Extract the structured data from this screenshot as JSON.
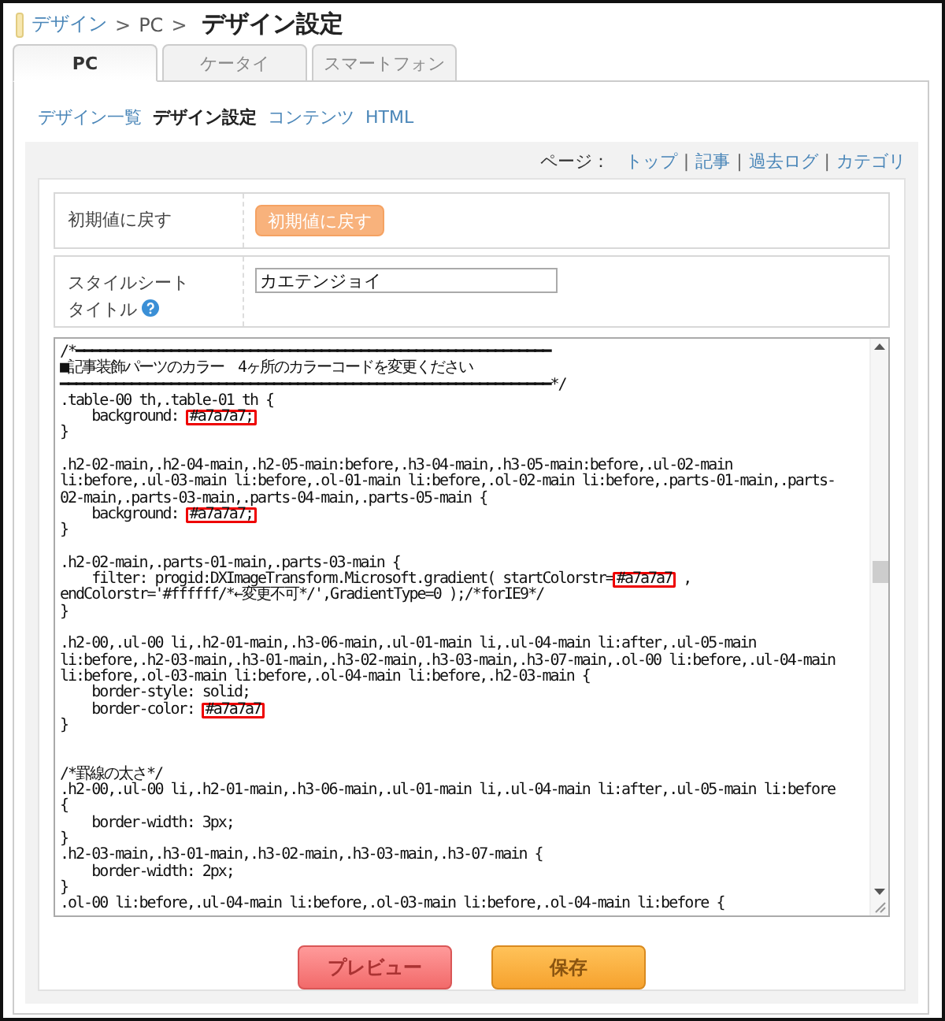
{
  "breadcrumb": {
    "items": [
      {
        "label": "デザイン",
        "kind": "link"
      },
      {
        "label": "PC",
        "kind": "plain"
      }
    ],
    "separator": ">",
    "current": "デザイン設定"
  },
  "tabs": [
    {
      "label": "PC",
      "selected": true
    },
    {
      "label": "ケータイ",
      "selected": false
    },
    {
      "label": "スマートフォン",
      "selected": false
    }
  ],
  "subnav": [
    {
      "label": "デザイン一覧",
      "selected": false
    },
    {
      "label": "デザイン設定",
      "selected": true
    },
    {
      "label": "コンテンツ",
      "selected": false
    },
    {
      "label": "HTML",
      "selected": false
    }
  ],
  "page_links": {
    "label": "ページ：",
    "separator": "|",
    "links": [
      "トップ",
      "記事",
      "過去ログ",
      "カテゴリ"
    ]
  },
  "reset_row": {
    "label": "初期値に戻す",
    "button": "初期値に戻す"
  },
  "title_row": {
    "label_lines": [
      "スタイルシート",
      "タイトル"
    ],
    "value": "カエテンジョイ"
  },
  "code_lines": [
    {
      "kind": "code",
      "text": "/*━━━━━━━━━━━━━━━━━━━━━━━━━━━━━━━━━━━━━━━━━━━━━━━━━━━━━━━━━━━━"
    },
    {
      "kind": "code",
      "text": "■記事装飾パーツのカラー　4ヶ所のカラーコードを変更ください"
    },
    {
      "kind": "code",
      "text": "━━━━━━━━━━━━━━━━━━━━━━━━━━━━━━━━━━━━━━━━━━━━━━━━━━━━━━━━━━━━━━*/"
    },
    {
      "kind": "code",
      "text": ".table-00 th,.table-01 th {"
    },
    {
      "kind": "marked",
      "text": "    background: ",
      "mark": "#a7a7a7;"
    },
    {
      "kind": "code",
      "text": "}"
    },
    {
      "kind": "blank"
    },
    {
      "kind": "code",
      "text": ".h2-02-main,.h2-04-main,.h2-05-main:before,.h3-04-main,.h3-05-main:before,.ul-02-main"
    },
    {
      "kind": "code",
      "text": "li:before,.ul-03-main li:before,.ol-01-main li:before,.ol-02-main li:before,.parts-01-main,.parts-"
    },
    {
      "kind": "code",
      "text": "02-main,.parts-03-main,.parts-04-main,.parts-05-main {"
    },
    {
      "kind": "marked",
      "text": "    background: ",
      "mark": "#a7a7a7;"
    },
    {
      "kind": "code",
      "text": "}"
    },
    {
      "kind": "blank"
    },
    {
      "kind": "code",
      "text": ".h2-02-main,.parts-01-main,.parts-03-main {"
    },
    {
      "kind": "marked",
      "text": "    filter: progid:DXImageTransform.Microsoft.gradient( startColorstr=",
      "mark": "#a7a7a7",
      "rest": " ,"
    },
    {
      "kind": "code",
      "text": "endColorstr='#ffffff/*←変更不可*/',GradientType=0 );/*forIE9*/"
    },
    {
      "kind": "code",
      "text": "}"
    },
    {
      "kind": "blank"
    },
    {
      "kind": "code",
      "text": ".h2-00,.ul-00 li,.h2-01-main,.h3-06-main,.ul-01-main li,.ul-04-main li:after,.ul-05-main"
    },
    {
      "kind": "code",
      "text": "li:before,.h2-03-main,.h3-01-main,.h3-02-main,.h3-03-main,.h3-07-main,.ol-00 li:before,.ul-04-main"
    },
    {
      "kind": "code",
      "text": "li:before,.ol-03-main li:before,.ol-04-main li:before,.h2-03-main {"
    },
    {
      "kind": "code",
      "text": "    border-style: solid;"
    },
    {
      "kind": "marked",
      "text": "    border-color: ",
      "mark": "#a7a7a7"
    },
    {
      "kind": "code",
      "text": "}"
    },
    {
      "kind": "blank"
    },
    {
      "kind": "blank"
    },
    {
      "kind": "code",
      "text": "/*罫線の太さ*/"
    },
    {
      "kind": "code",
      "text": ".h2-00,.ul-00 li,.h2-01-main,.h3-06-main,.ul-01-main li,.ul-04-main li:after,.ul-05-main li:before"
    },
    {
      "kind": "code",
      "text": "{"
    },
    {
      "kind": "code",
      "text": "    border-width: 3px;"
    },
    {
      "kind": "code",
      "text": "}"
    },
    {
      "kind": "code",
      "text": ".h2-03-main,.h3-01-main,.h3-02-main,.h3-03-main,.h3-07-main {"
    },
    {
      "kind": "code",
      "text": "    border-width: 2px;"
    },
    {
      "kind": "code",
      "text": "}"
    },
    {
      "kind": "code",
      "text": ".ol-00 li:before,.ul-04-main li:before,.ol-03-main li:before,.ol-04-main li:before {"
    }
  ],
  "buttons": [
    {
      "label": "プレビュー",
      "kind": "preview"
    },
    {
      "label": "保存",
      "kind": "save"
    }
  ]
}
